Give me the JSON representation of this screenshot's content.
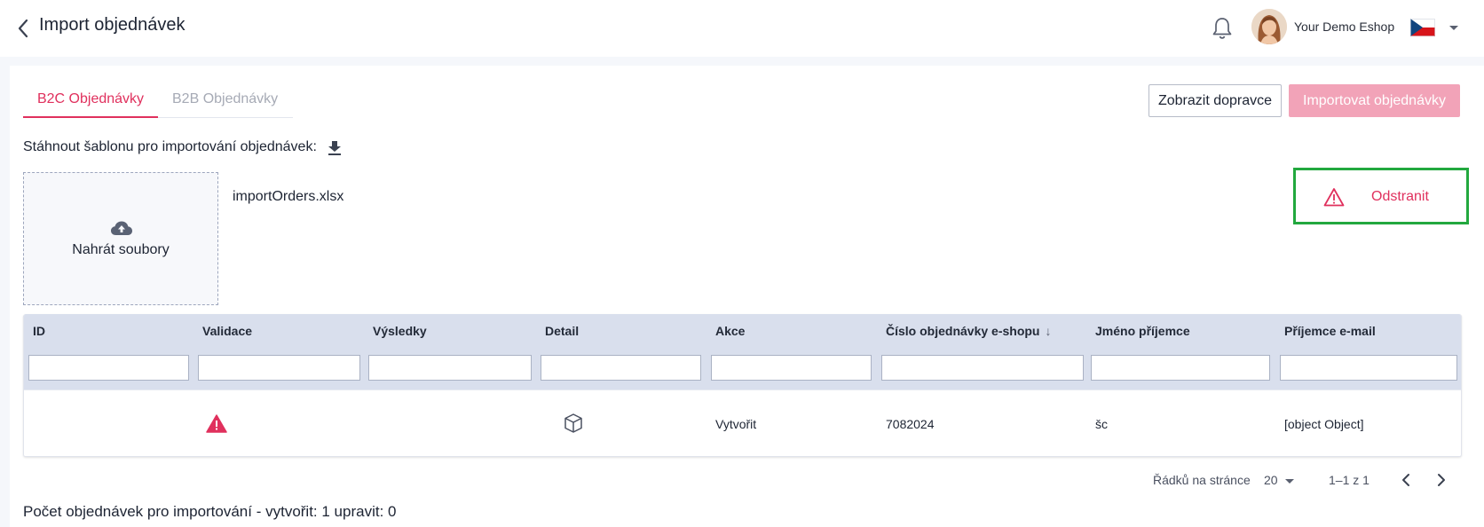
{
  "header": {
    "title": "Import objednávek",
    "eshop_name": "Your Demo Eshop"
  },
  "tabs": [
    {
      "label": "B2C Objednávky",
      "active": true
    },
    {
      "label": "B2B Objednávky",
      "active": false
    }
  ],
  "actions": {
    "show_carriers": "Zobrazit dopravce",
    "import_orders": "Importovat objednávky"
  },
  "template": {
    "label": "Stáhnout šablonu pro importování objednávek:"
  },
  "upload": {
    "label": "Nahrát soubory",
    "filename": "importOrders.xlsx",
    "remove_label": "Odstranit"
  },
  "table": {
    "columns": [
      "ID",
      "Validace",
      "Výsledky",
      "Detail",
      "Akce",
      "Číslo objednávky e-shopu",
      "Jméno příjemce",
      "Příjemce e-mail"
    ],
    "rows": [
      {
        "id": "",
        "validation": "warning",
        "results": "",
        "detail": "package",
        "action": "Vytvořit",
        "order_number": "7082024",
        "recipient_name": "šc",
        "recipient_email": "[object Object]"
      }
    ]
  },
  "pagination": {
    "rows_per_page_label": "Řádků na stránce",
    "rows_per_page": "20",
    "range": "1–1 z 1"
  },
  "summary": "Počet objednávek pro importování - vytvořit: 1 upravit: 0",
  "colors": {
    "accent": "#e0305d",
    "accent_disabled": "#f2a3b8",
    "table_header": "#d9dfed",
    "highlight": "#22a83e"
  }
}
